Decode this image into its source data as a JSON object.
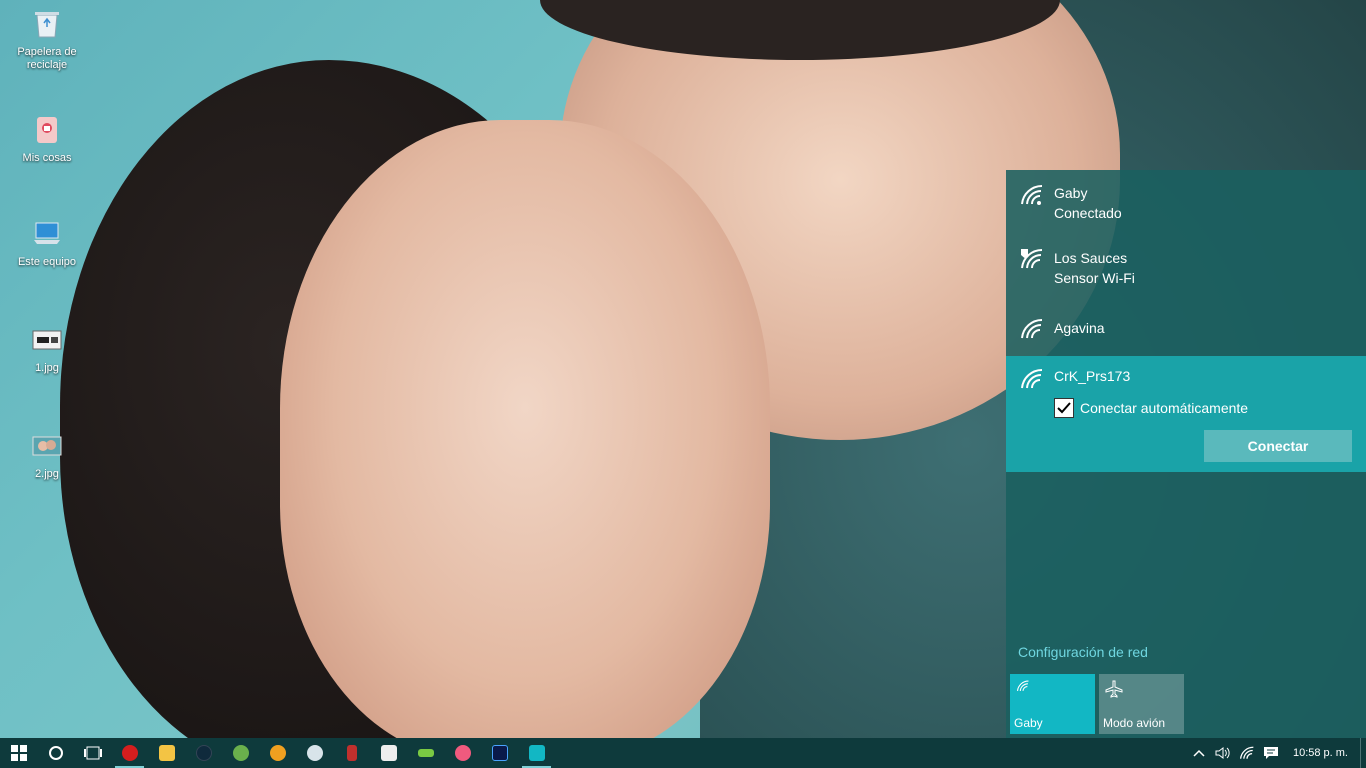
{
  "desktop": {
    "icons": [
      {
        "label": "Papelera de\nreciclaje",
        "icon": "recycle-bin-icon"
      },
      {
        "label": "Mis cosas",
        "icon": "folder-icon"
      },
      {
        "label": "Este equipo",
        "icon": "computer-icon"
      },
      {
        "label": "1.jpg",
        "icon": "image-file-icon"
      },
      {
        "label": "2.jpg",
        "icon": "image-file-icon"
      }
    ]
  },
  "network_flyout": {
    "networks": [
      {
        "name": "Gaby",
        "status": "Conectado",
        "secured": true
      },
      {
        "name": "Los Sauces",
        "status": "Sensor Wi-Fi",
        "secured": false
      },
      {
        "name": "Agavina",
        "status": "",
        "secured": true
      },
      {
        "name": "CrK_Prs173",
        "status": "",
        "secured": true,
        "selected": true
      }
    ],
    "auto_connect_label": "Conectar automáticamente",
    "auto_connect_checked": true,
    "connect_button": "Conectar",
    "settings_link": "Configuración de red",
    "tiles": [
      {
        "label": "Gaby",
        "icon": "wifi-icon",
        "active": true
      },
      {
        "label": "Modo avión",
        "icon": "airplane-icon",
        "active": false
      }
    ]
  },
  "taskbar": {
    "clock": "10:58 p. m.",
    "colors": {
      "background": "#0e3a3c",
      "accent": "#1aa3a8"
    }
  }
}
